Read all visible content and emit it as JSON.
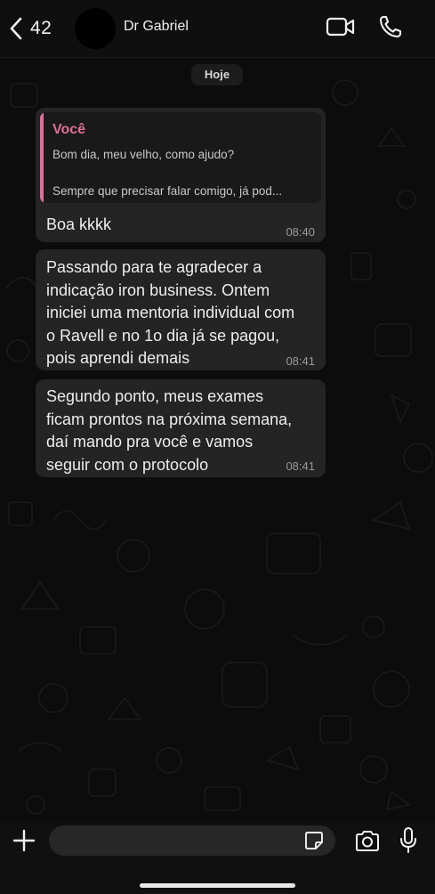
{
  "header": {
    "back_count": "42",
    "contact_name": "Dr Gabriel"
  },
  "chat": {
    "date_label": "Hoje",
    "messages": [
      {
        "quote_author": "Você",
        "quote_line1": "Bom dia, meu velho, como ajudo?",
        "quote_line2": "Sempre que precisar falar comigo, já pod...",
        "text": "Boa kkkk",
        "time": "08:40"
      },
      {
        "text": "Passando para te agradecer a\nindicação iron business. Ontem\niniciei uma mentoria individual com\no Ravell e no 1o dia já se pagou,\npois aprendi demais",
        "time": "08:41"
      },
      {
        "text": "Segundo ponto, meus exames\nficam prontos na próxima semana,\ndaí mando pra você e vamos\nseguir com o protocolo",
        "time": "08:41"
      }
    ]
  },
  "icons": {
    "back": "chevron-left-icon",
    "video": "video-camera-icon",
    "call": "phone-icon",
    "add": "plus-icon",
    "sticker": "sticker-icon",
    "camera": "camera-icon",
    "mic": "microphone-icon"
  },
  "colors": {
    "accent_quote": "#e06e9a",
    "bubble": "#242424",
    "background": "#0c0c0c"
  }
}
